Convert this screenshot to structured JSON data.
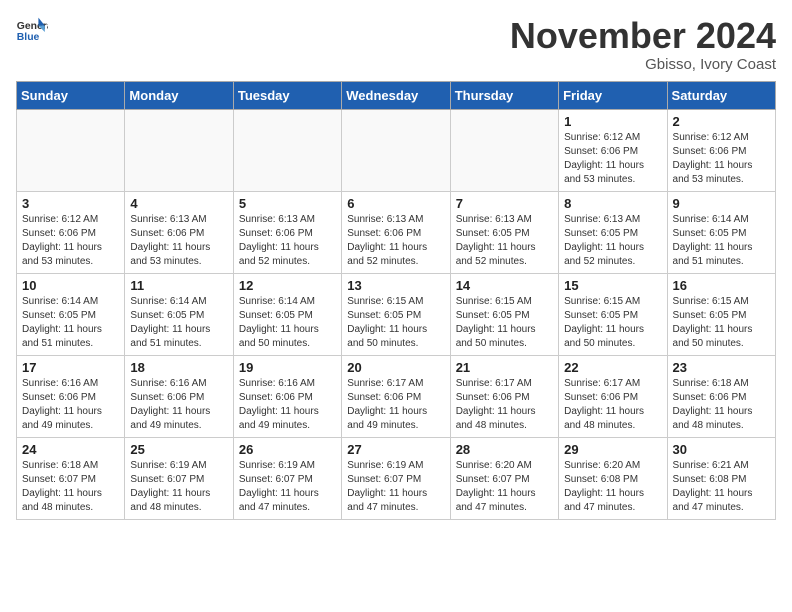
{
  "header": {
    "logo_line1": "General",
    "logo_line2": "Blue",
    "month_title": "November 2024",
    "location": "Gbisso, Ivory Coast"
  },
  "weekdays": [
    "Sunday",
    "Monday",
    "Tuesday",
    "Wednesday",
    "Thursday",
    "Friday",
    "Saturday"
  ],
  "weeks": [
    [
      {
        "day": "",
        "info": ""
      },
      {
        "day": "",
        "info": ""
      },
      {
        "day": "",
        "info": ""
      },
      {
        "day": "",
        "info": ""
      },
      {
        "day": "",
        "info": ""
      },
      {
        "day": "1",
        "info": "Sunrise: 6:12 AM\nSunset: 6:06 PM\nDaylight: 11 hours\nand 53 minutes."
      },
      {
        "day": "2",
        "info": "Sunrise: 6:12 AM\nSunset: 6:06 PM\nDaylight: 11 hours\nand 53 minutes."
      }
    ],
    [
      {
        "day": "3",
        "info": "Sunrise: 6:12 AM\nSunset: 6:06 PM\nDaylight: 11 hours\nand 53 minutes."
      },
      {
        "day": "4",
        "info": "Sunrise: 6:13 AM\nSunset: 6:06 PM\nDaylight: 11 hours\nand 53 minutes."
      },
      {
        "day": "5",
        "info": "Sunrise: 6:13 AM\nSunset: 6:06 PM\nDaylight: 11 hours\nand 52 minutes."
      },
      {
        "day": "6",
        "info": "Sunrise: 6:13 AM\nSunset: 6:06 PM\nDaylight: 11 hours\nand 52 minutes."
      },
      {
        "day": "7",
        "info": "Sunrise: 6:13 AM\nSunset: 6:05 PM\nDaylight: 11 hours\nand 52 minutes."
      },
      {
        "day": "8",
        "info": "Sunrise: 6:13 AM\nSunset: 6:05 PM\nDaylight: 11 hours\nand 52 minutes."
      },
      {
        "day": "9",
        "info": "Sunrise: 6:14 AM\nSunset: 6:05 PM\nDaylight: 11 hours\nand 51 minutes."
      }
    ],
    [
      {
        "day": "10",
        "info": "Sunrise: 6:14 AM\nSunset: 6:05 PM\nDaylight: 11 hours\nand 51 minutes."
      },
      {
        "day": "11",
        "info": "Sunrise: 6:14 AM\nSunset: 6:05 PM\nDaylight: 11 hours\nand 51 minutes."
      },
      {
        "day": "12",
        "info": "Sunrise: 6:14 AM\nSunset: 6:05 PM\nDaylight: 11 hours\nand 50 minutes."
      },
      {
        "day": "13",
        "info": "Sunrise: 6:15 AM\nSunset: 6:05 PM\nDaylight: 11 hours\nand 50 minutes."
      },
      {
        "day": "14",
        "info": "Sunrise: 6:15 AM\nSunset: 6:05 PM\nDaylight: 11 hours\nand 50 minutes."
      },
      {
        "day": "15",
        "info": "Sunrise: 6:15 AM\nSunset: 6:05 PM\nDaylight: 11 hours\nand 50 minutes."
      },
      {
        "day": "16",
        "info": "Sunrise: 6:15 AM\nSunset: 6:05 PM\nDaylight: 11 hours\nand 50 minutes."
      }
    ],
    [
      {
        "day": "17",
        "info": "Sunrise: 6:16 AM\nSunset: 6:06 PM\nDaylight: 11 hours\nand 49 minutes."
      },
      {
        "day": "18",
        "info": "Sunrise: 6:16 AM\nSunset: 6:06 PM\nDaylight: 11 hours\nand 49 minutes."
      },
      {
        "day": "19",
        "info": "Sunrise: 6:16 AM\nSunset: 6:06 PM\nDaylight: 11 hours\nand 49 minutes."
      },
      {
        "day": "20",
        "info": "Sunrise: 6:17 AM\nSunset: 6:06 PM\nDaylight: 11 hours\nand 49 minutes."
      },
      {
        "day": "21",
        "info": "Sunrise: 6:17 AM\nSunset: 6:06 PM\nDaylight: 11 hours\nand 48 minutes."
      },
      {
        "day": "22",
        "info": "Sunrise: 6:17 AM\nSunset: 6:06 PM\nDaylight: 11 hours\nand 48 minutes."
      },
      {
        "day": "23",
        "info": "Sunrise: 6:18 AM\nSunset: 6:06 PM\nDaylight: 11 hours\nand 48 minutes."
      }
    ],
    [
      {
        "day": "24",
        "info": "Sunrise: 6:18 AM\nSunset: 6:07 PM\nDaylight: 11 hours\nand 48 minutes."
      },
      {
        "day": "25",
        "info": "Sunrise: 6:19 AM\nSunset: 6:07 PM\nDaylight: 11 hours\nand 48 minutes."
      },
      {
        "day": "26",
        "info": "Sunrise: 6:19 AM\nSunset: 6:07 PM\nDaylight: 11 hours\nand 47 minutes."
      },
      {
        "day": "27",
        "info": "Sunrise: 6:19 AM\nSunset: 6:07 PM\nDaylight: 11 hours\nand 47 minutes."
      },
      {
        "day": "28",
        "info": "Sunrise: 6:20 AM\nSunset: 6:07 PM\nDaylight: 11 hours\nand 47 minutes."
      },
      {
        "day": "29",
        "info": "Sunrise: 6:20 AM\nSunset: 6:08 PM\nDaylight: 11 hours\nand 47 minutes."
      },
      {
        "day": "30",
        "info": "Sunrise: 6:21 AM\nSunset: 6:08 PM\nDaylight: 11 hours\nand 47 minutes."
      }
    ]
  ]
}
